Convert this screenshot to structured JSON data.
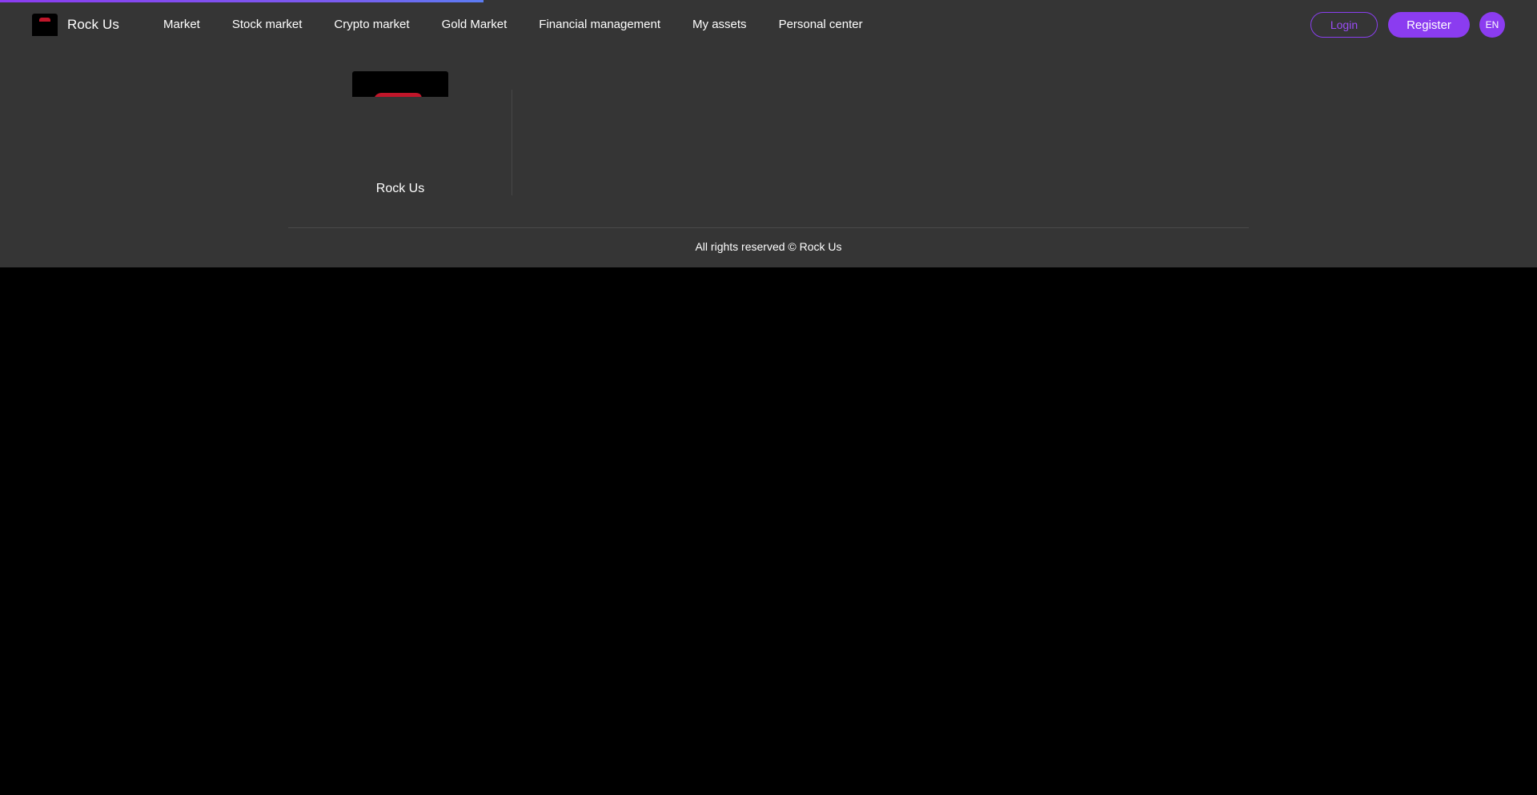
{
  "header": {
    "brand_name": "Rock Us",
    "nav": [
      {
        "label": "Market"
      },
      {
        "label": "Stock market"
      },
      {
        "label": "Crypto market"
      },
      {
        "label": "Gold Market"
      },
      {
        "label": "Financial management"
      },
      {
        "label": "My assets"
      },
      {
        "label": "Personal center"
      }
    ],
    "login_label": "Login",
    "register_label": "Register",
    "language": "EN"
  },
  "footer": {
    "brand_name": "Rock Us",
    "copyright": "All rights reserved © Rock Us"
  },
  "colors": {
    "accent": "#8b3cf0",
    "background": "#353535",
    "page_bottom": "#000000",
    "logo_red": "#c0162a"
  },
  "icons": {
    "brand_logo": "rock-us-logo"
  }
}
